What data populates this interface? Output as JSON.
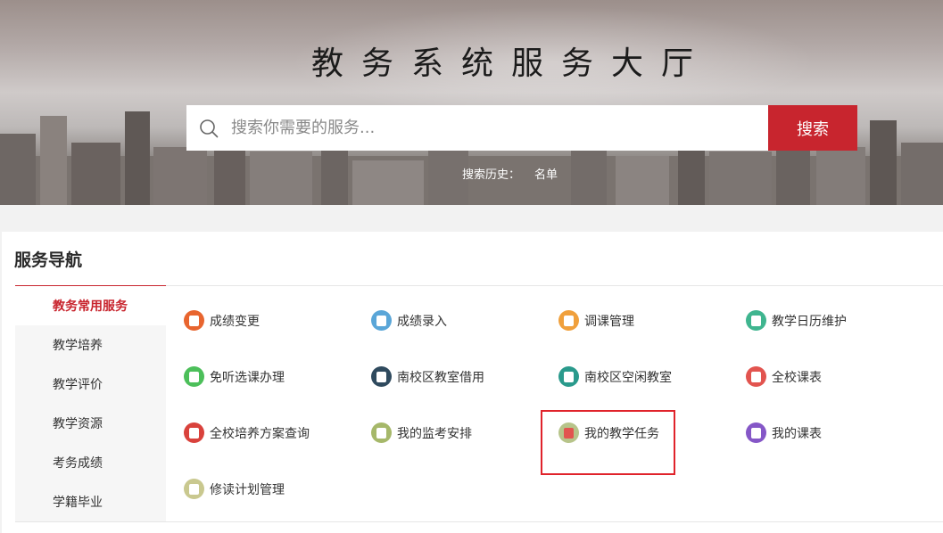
{
  "hero": {
    "title": "教务系统服务大厅",
    "search_placeholder": "搜索你需要的服务...",
    "search_button": "搜索",
    "history_label": "搜索历史：",
    "history_items": [
      "名单"
    ]
  },
  "panel": {
    "title": "服务导航",
    "tabs": [
      "教务常用服务",
      "教学培养",
      "教学评价",
      "教学资源",
      "考务成绩",
      "学籍毕业"
    ],
    "active_tab": "教务常用服务",
    "items": [
      {
        "label": "成绩变更",
        "icon": "grade-change-icon",
        "color": "#e8652f"
      },
      {
        "label": "成绩录入",
        "icon": "grade-entry-icon",
        "color": "#5aa6d8"
      },
      {
        "label": "调课管理",
        "icon": "schedule-adjust-icon",
        "color": "#f0a03c"
      },
      {
        "label": "教学日历维护",
        "icon": "calendar-icon",
        "color": "#3fb58f"
      },
      {
        "label": "免听选课办理",
        "icon": "exempt-course-icon",
        "color": "#4cbf5a"
      },
      {
        "label": "南校区教室借用",
        "icon": "classroom-borrow-icon",
        "color": "#2f4a5e"
      },
      {
        "label": "南校区空闲教室",
        "icon": "free-classroom-icon",
        "color": "#2a9a8c"
      },
      {
        "label": "全校课表",
        "icon": "school-timetable-icon",
        "color": "#e2544f"
      },
      {
        "label": "全校培养方案查询",
        "icon": "training-plan-icon",
        "color": "#d9423c"
      },
      {
        "label": "我的监考安排",
        "icon": "invigilation-icon",
        "color": "#a6b86a"
      },
      {
        "label": "我的教学任务",
        "icon": "teaching-task-icon",
        "color": "#b7c48a"
      },
      {
        "label": "我的课表",
        "icon": "my-timetable-icon",
        "color": "#8557c7"
      },
      {
        "label": "修读计划管理",
        "icon": "study-plan-icon",
        "color": "#c9c88f"
      }
    ]
  }
}
